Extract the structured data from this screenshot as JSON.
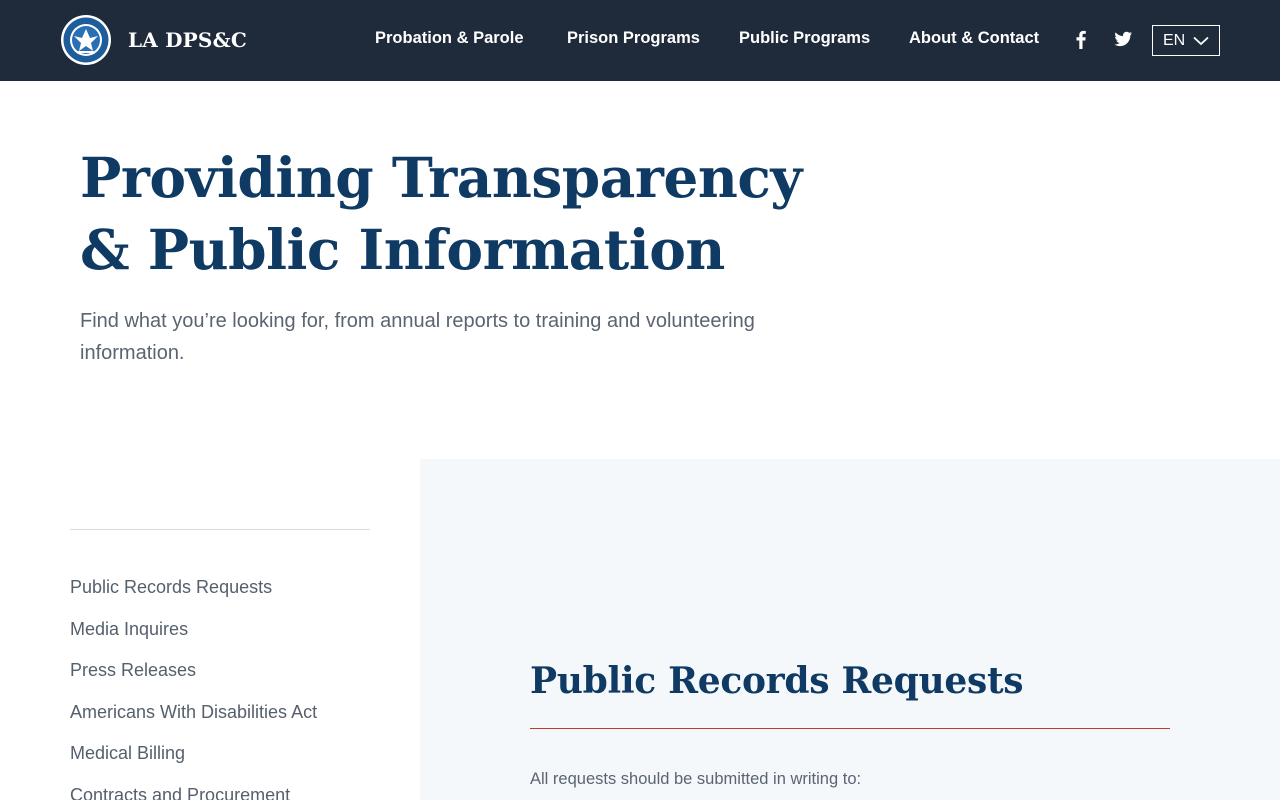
{
  "header": {
    "brand": "LA DPS&C",
    "nav": [
      {
        "label": "Probation & Parole"
      },
      {
        "label": "Prison Programs"
      },
      {
        "label": "Public Programs"
      },
      {
        "label": "About & Contact"
      }
    ],
    "social": {
      "facebook_icon": "facebook-icon",
      "twitter_icon": "twitter-icon"
    },
    "language": "EN"
  },
  "hero": {
    "title": "Providing Transparency & Public Information",
    "subtitle": "Find what you’re looking for, from annual reports to training and volunteering information."
  },
  "sidebar": {
    "items": [
      {
        "label": "Public Records Requests"
      },
      {
        "label": "Media Inquires"
      },
      {
        "label": "Press Releases"
      },
      {
        "label": "Americans With Disabilities Act"
      },
      {
        "label": "Medical Billing"
      },
      {
        "label": "Contracts and Procurement"
      }
    ]
  },
  "content": {
    "title": "Public Records Requests",
    "intro": "All requests should be submitted in writing to:"
  },
  "colors": {
    "header_bg": "#1f2b3b",
    "heading": "#0f3a63",
    "accent_rule": "#c0392b",
    "panel_bg": "#f5f8fb"
  }
}
